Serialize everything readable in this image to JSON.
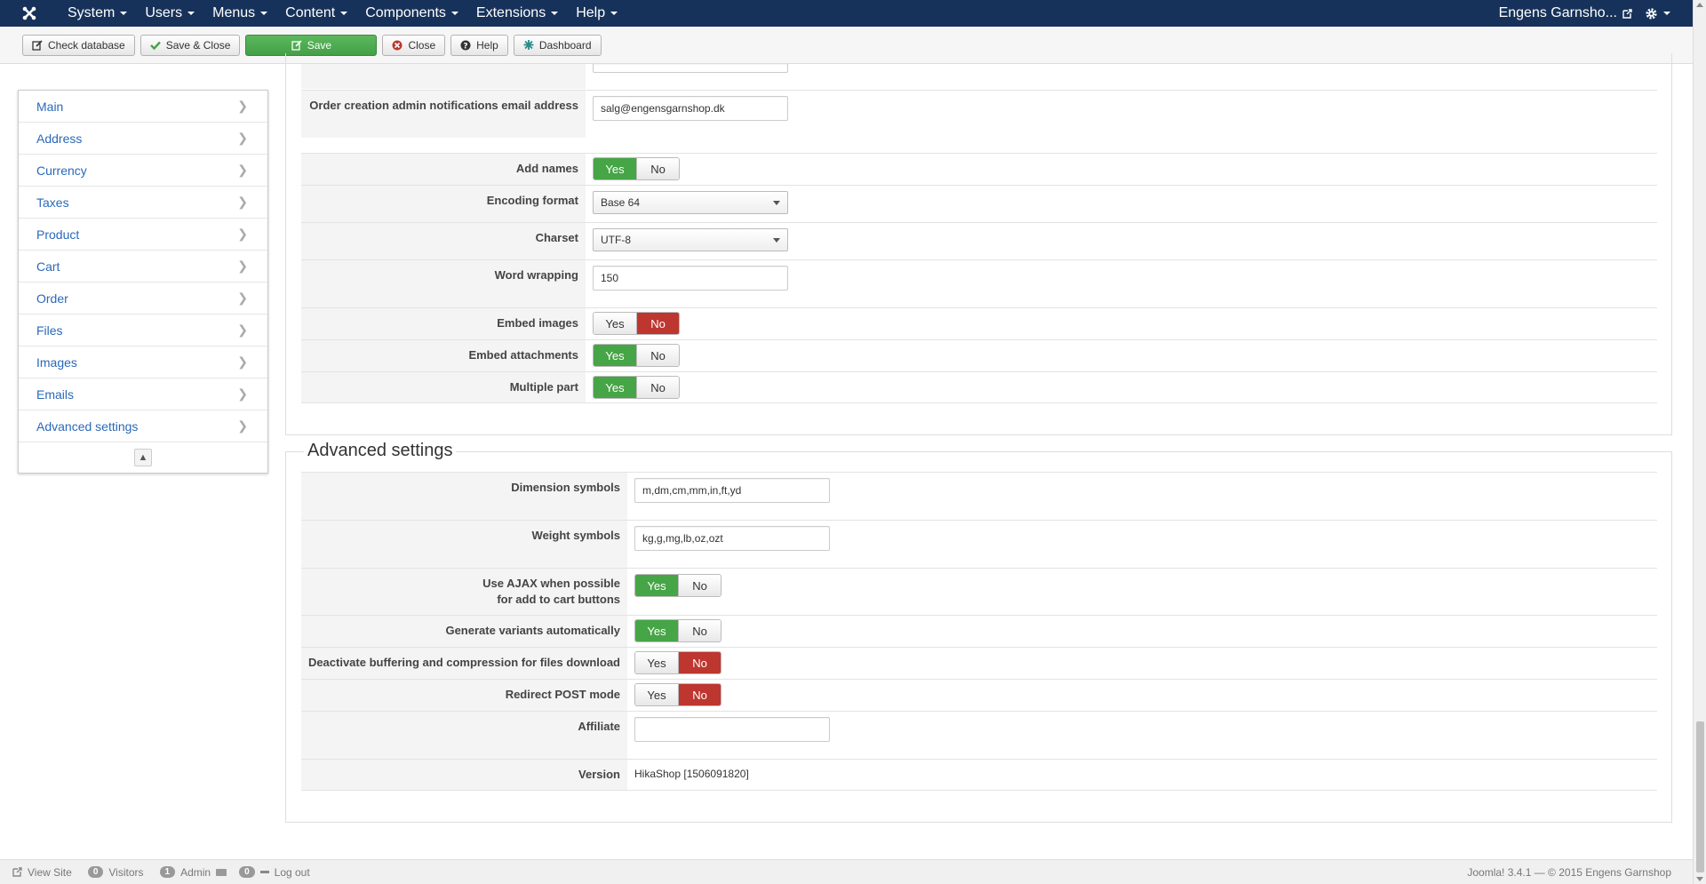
{
  "navbar": {
    "menu": [
      "System",
      "Users",
      "Menus",
      "Content",
      "Components",
      "Extensions",
      "Help"
    ],
    "user_label": "Engens Garnsho...",
    "bg_color": "#17325a"
  },
  "toolbar": {
    "check_database": "Check database",
    "save_close": "Save & Close",
    "save": "Save",
    "close": "Close",
    "help": "Help",
    "dashboard": "Dashboard"
  },
  "sidebar": {
    "items": [
      "Main",
      "Address",
      "Currency",
      "Taxes",
      "Product",
      "Cart",
      "Order",
      "Files",
      "Images",
      "Emails",
      "Advanced settings"
    ]
  },
  "email_settings": {
    "order_admin_email_label": "Order creation admin notifications email address",
    "order_admin_email_value": "salg@engensgarnshop.dk",
    "add_names_label": "Add names",
    "encoding_label": "Encoding format",
    "encoding_value": "Base 64",
    "charset_label": "Charset",
    "charset_value": "UTF-8",
    "word_wrapping_label": "Word wrapping",
    "word_wrapping_value": "150",
    "embed_images_label": "Embed images",
    "embed_attachments_label": "Embed attachments",
    "multiple_part_label": "Multiple part"
  },
  "advanced": {
    "legend": "Advanced settings",
    "dimension_label": "Dimension symbols",
    "dimension_value": "m,dm,cm,mm,in,ft,yd",
    "weight_label": "Weight symbols",
    "weight_value": "kg,g,mg,lb,oz,ozt",
    "ajax_label_1": "Use AJAX when possible",
    "ajax_label_2": "for add to cart buttons",
    "variants_label": "Generate variants automatically",
    "buffering_label": "Deactivate buffering and compression for files download",
    "redirect_label": "Redirect POST mode",
    "affiliate_label": "Affiliate",
    "affiliate_value": "",
    "version_label": "Version",
    "version_value": "HikaShop [1506091820]"
  },
  "toggle": {
    "yes": "Yes",
    "no": "No"
  },
  "footer": {
    "view_site": "View Site",
    "visitors_count": "0",
    "visitors": "Visitors",
    "admin_count": "1",
    "admin": "Admin",
    "messages_count": "0",
    "logout": "Log out",
    "copyright": "Joomla! 3.4.1 — © 2015 Engens Garnshop"
  }
}
